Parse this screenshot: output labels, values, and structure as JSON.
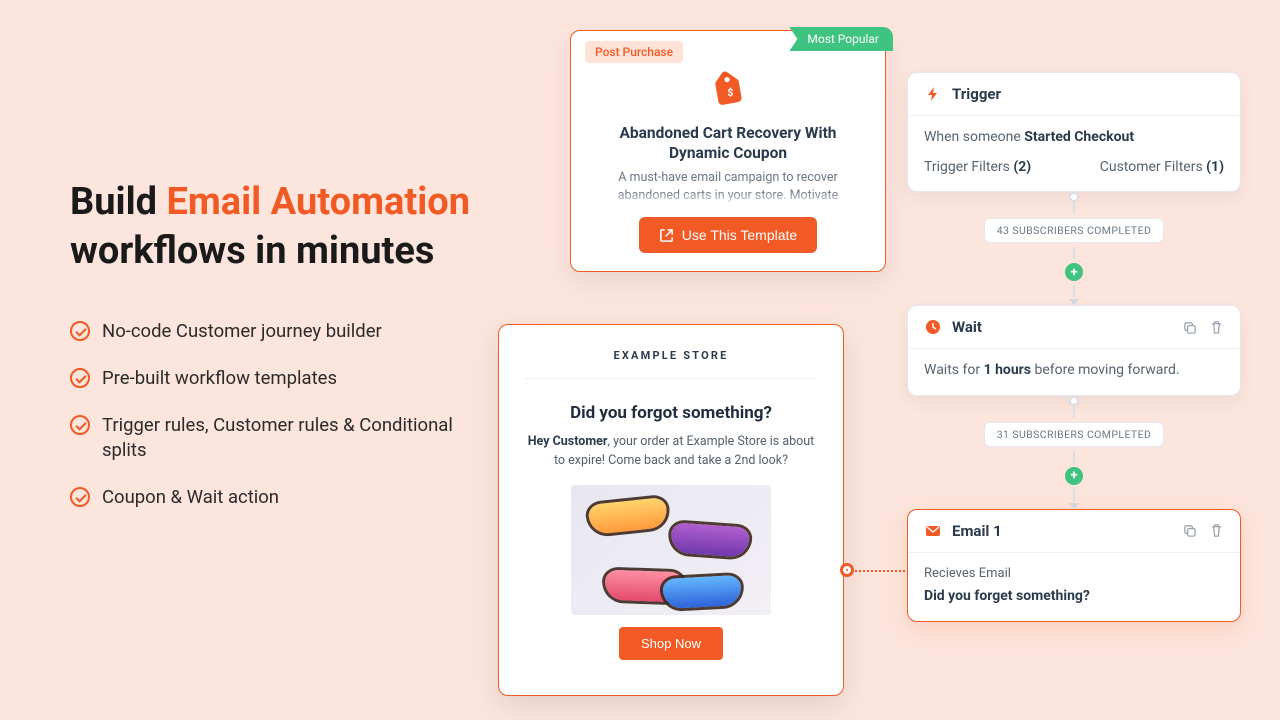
{
  "headline": {
    "part1": "Build ",
    "accent": "Email Automation",
    "part2": " workflows in minutes"
  },
  "features": [
    "No-code Customer journey builder",
    "Pre-built workflow templates",
    "Trigger rules, Customer rules & Conditional splits",
    "Coupon & Wait action"
  ],
  "template_card": {
    "tag": "Post Purchase",
    "ribbon": "Most Popular",
    "title": "Abandoned Cart Recovery With Dynamic Coupon",
    "description": "A must-have email campaign to recover abandoned carts in your store. Motivate customers with a dynamic coupon code to",
    "cta": "Use This Template"
  },
  "email_preview": {
    "store": "EXAMPLE STORE",
    "title": "Did you forgot something?",
    "body_pre": "Hey Customer",
    "body_rest": ", your order at Example Store is about to expire! Come back and take a 2nd look?",
    "cta": "Shop Now"
  },
  "flow": {
    "trigger": {
      "label": "Trigger",
      "when_pre": "When someone ",
      "when_event": "Started Checkout",
      "trigger_filters_label": "Trigger Filters ",
      "trigger_filters_count": "(2)",
      "customer_filters_label": "Customer Filters ",
      "customer_filters_count": "(1)"
    },
    "stat1": "43 SUBSCRIBERS COMPLETED",
    "wait": {
      "label": "Wait",
      "text_pre": "Waits for ",
      "text_bold": "1 hours",
      "text_post": " before moving forward."
    },
    "stat2": "31 SUBSCRIBERS COMPLETED",
    "email": {
      "label": "Email 1",
      "sub": "Recieves Email",
      "subject": "Did you forget something?"
    }
  },
  "colors": {
    "accent": "#f15a24",
    "green": "#3fc380"
  }
}
